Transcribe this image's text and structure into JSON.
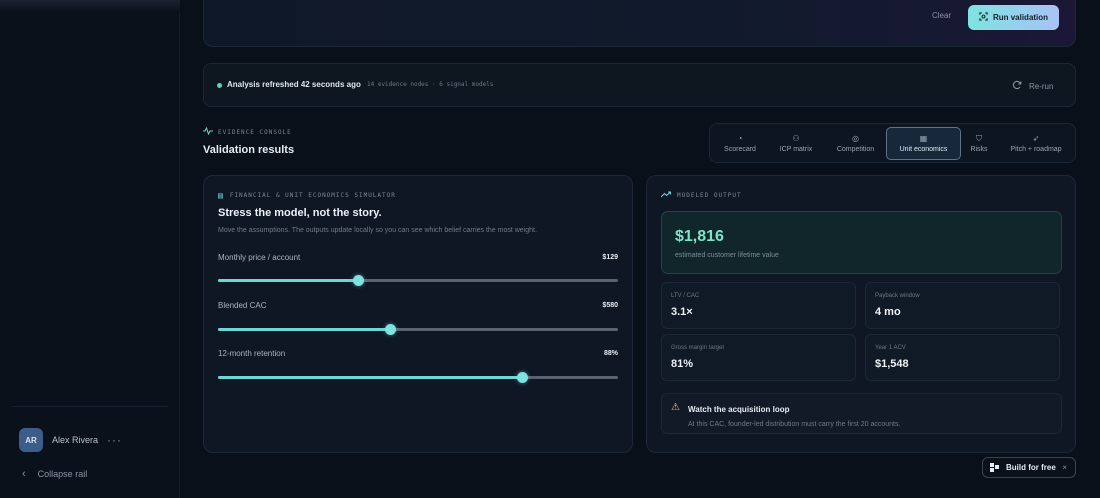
{
  "user": {
    "initials": "AR",
    "name": "Alex Rivera",
    "more_icon": "ellipsis-icon"
  },
  "sidebar": {
    "collapse_label": "Collapse rail"
  },
  "toolbar": {
    "clear_label": "Clear",
    "run_label": "Run validation"
  },
  "status": {
    "refreshed": "Analysis refreshed 42 seconds ago",
    "meta": "14 evidence nodes · 6 signal models",
    "rerun_label": "Re-run"
  },
  "section": {
    "eyebrow": "EVIDENCE CONSOLE",
    "title": "Validation results"
  },
  "tabs": [
    {
      "label": "Scorecard",
      "icon": "gauge-icon"
    },
    {
      "label": "ICP matrix",
      "icon": "users-icon"
    },
    {
      "label": "Competition",
      "icon": "target-icon"
    },
    {
      "label": "Unit economics",
      "icon": "calculator-icon",
      "active": true
    },
    {
      "label": "Risks",
      "icon": "shield-icon"
    },
    {
      "label": "Pitch + roadmap",
      "icon": "rocket-icon"
    }
  ],
  "simulator": {
    "eyebrow": "FINANCIAL & UNIT ECONOMICS SIMULATOR",
    "title": "Stress the model, not the story.",
    "subtitle": "Move the assumptions. The outputs update locally so you can see which belief carries the most weight.",
    "sliders": [
      {
        "label": "Monthly price / account",
        "value": "$129",
        "level": 0.35
      },
      {
        "label": "Blended CAC",
        "value": "$580",
        "level": 0.43
      },
      {
        "label": "12-month retention",
        "value": "88%",
        "level": 0.76
      }
    ]
  },
  "output": {
    "eyebrow": "MODELED OUTPUT",
    "hero_value": "$1,816",
    "hero_caption": "estimated customer lifetime value",
    "metrics": [
      {
        "label": "LTV / CAC",
        "value": "3.1×"
      },
      {
        "label": "Payback window",
        "value": "4 mo"
      },
      {
        "label": "Gross margin target",
        "value": "81%"
      },
      {
        "label": "Year 1 ACV",
        "value": "$1,548"
      }
    ],
    "callout_title": "Watch the acquisition loop",
    "callout_text": "At this CAC, founder-led distribution must carry the first 20 accounts."
  },
  "build": {
    "label": "Build for free",
    "close": "×"
  },
  "colors": {
    "accent": "#6ed6d4",
    "success": "#57d6b2",
    "warning": "#e7c46c"
  }
}
